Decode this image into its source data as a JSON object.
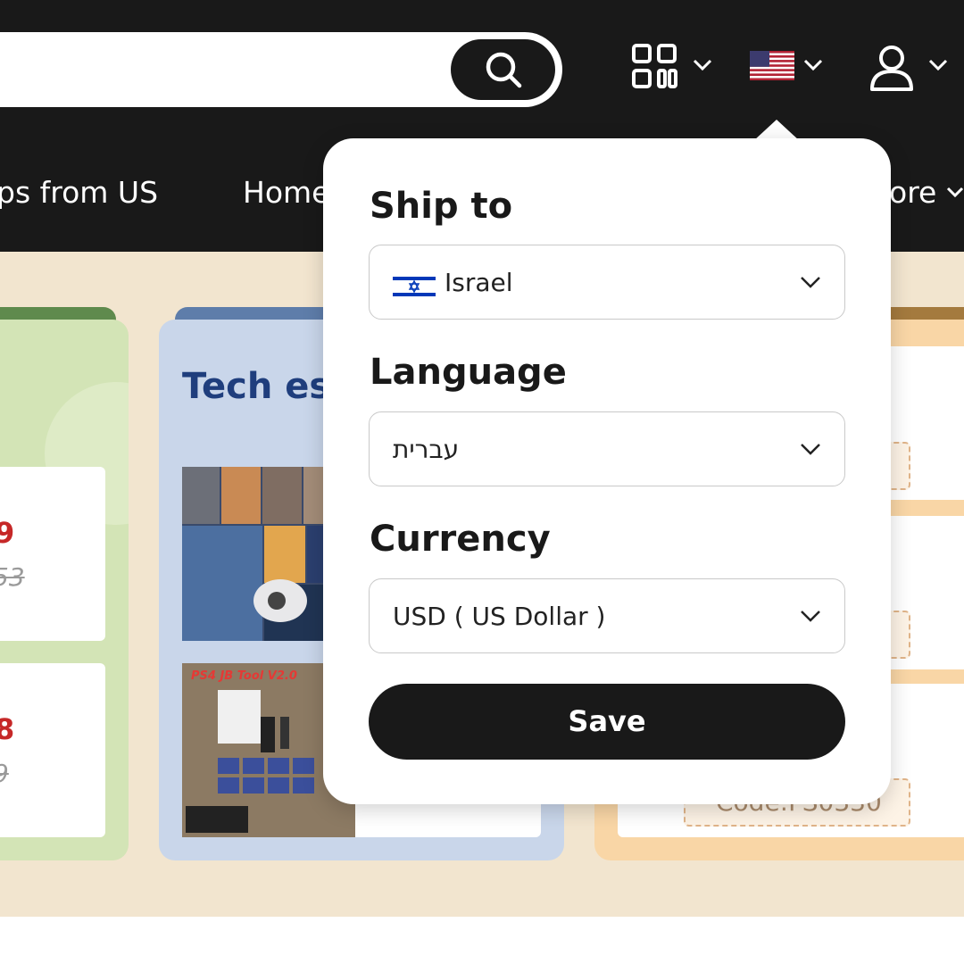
{
  "header": {
    "nav_items": [
      {
        "label": "ps from US"
      },
      {
        "label": "Home"
      },
      {
        "label": "ore"
      }
    ]
  },
  "promo": {
    "green_card": {
      "prices": [
        "9",
        "8"
      ],
      "old_prices": [
        "53",
        "9"
      ]
    },
    "tech_card": {
      "title": "Tech ess",
      "product_label": "PS4 JB Tool V2.0"
    },
    "coupon_card": {
      "coupon_code": "Code:FS0330"
    }
  },
  "popup": {
    "ship_to_label": "Ship to",
    "ship_to_value": "Israel",
    "language_label": "Language",
    "language_value": "עברית",
    "currency_label": "Currency",
    "currency_value": "USD ( US Dollar )",
    "save_label": "Save"
  },
  "icons": {
    "search": "search-icon",
    "qr": "qr-code-icon",
    "flag_us": "us-flag-icon",
    "flag_il": "israel-flag-icon",
    "user": "user-icon",
    "chevron": "chevron-down-icon"
  },
  "colors": {
    "header_bg": "#191919",
    "page_bg": "#f2e5cf",
    "green_card": "#d3e4b6",
    "blue_card": "#c9d6ea",
    "orange_card": "#f9d6a6",
    "price_red": "#c62828",
    "tech_title": "#1f3e7d",
    "save_button": "#191919"
  }
}
